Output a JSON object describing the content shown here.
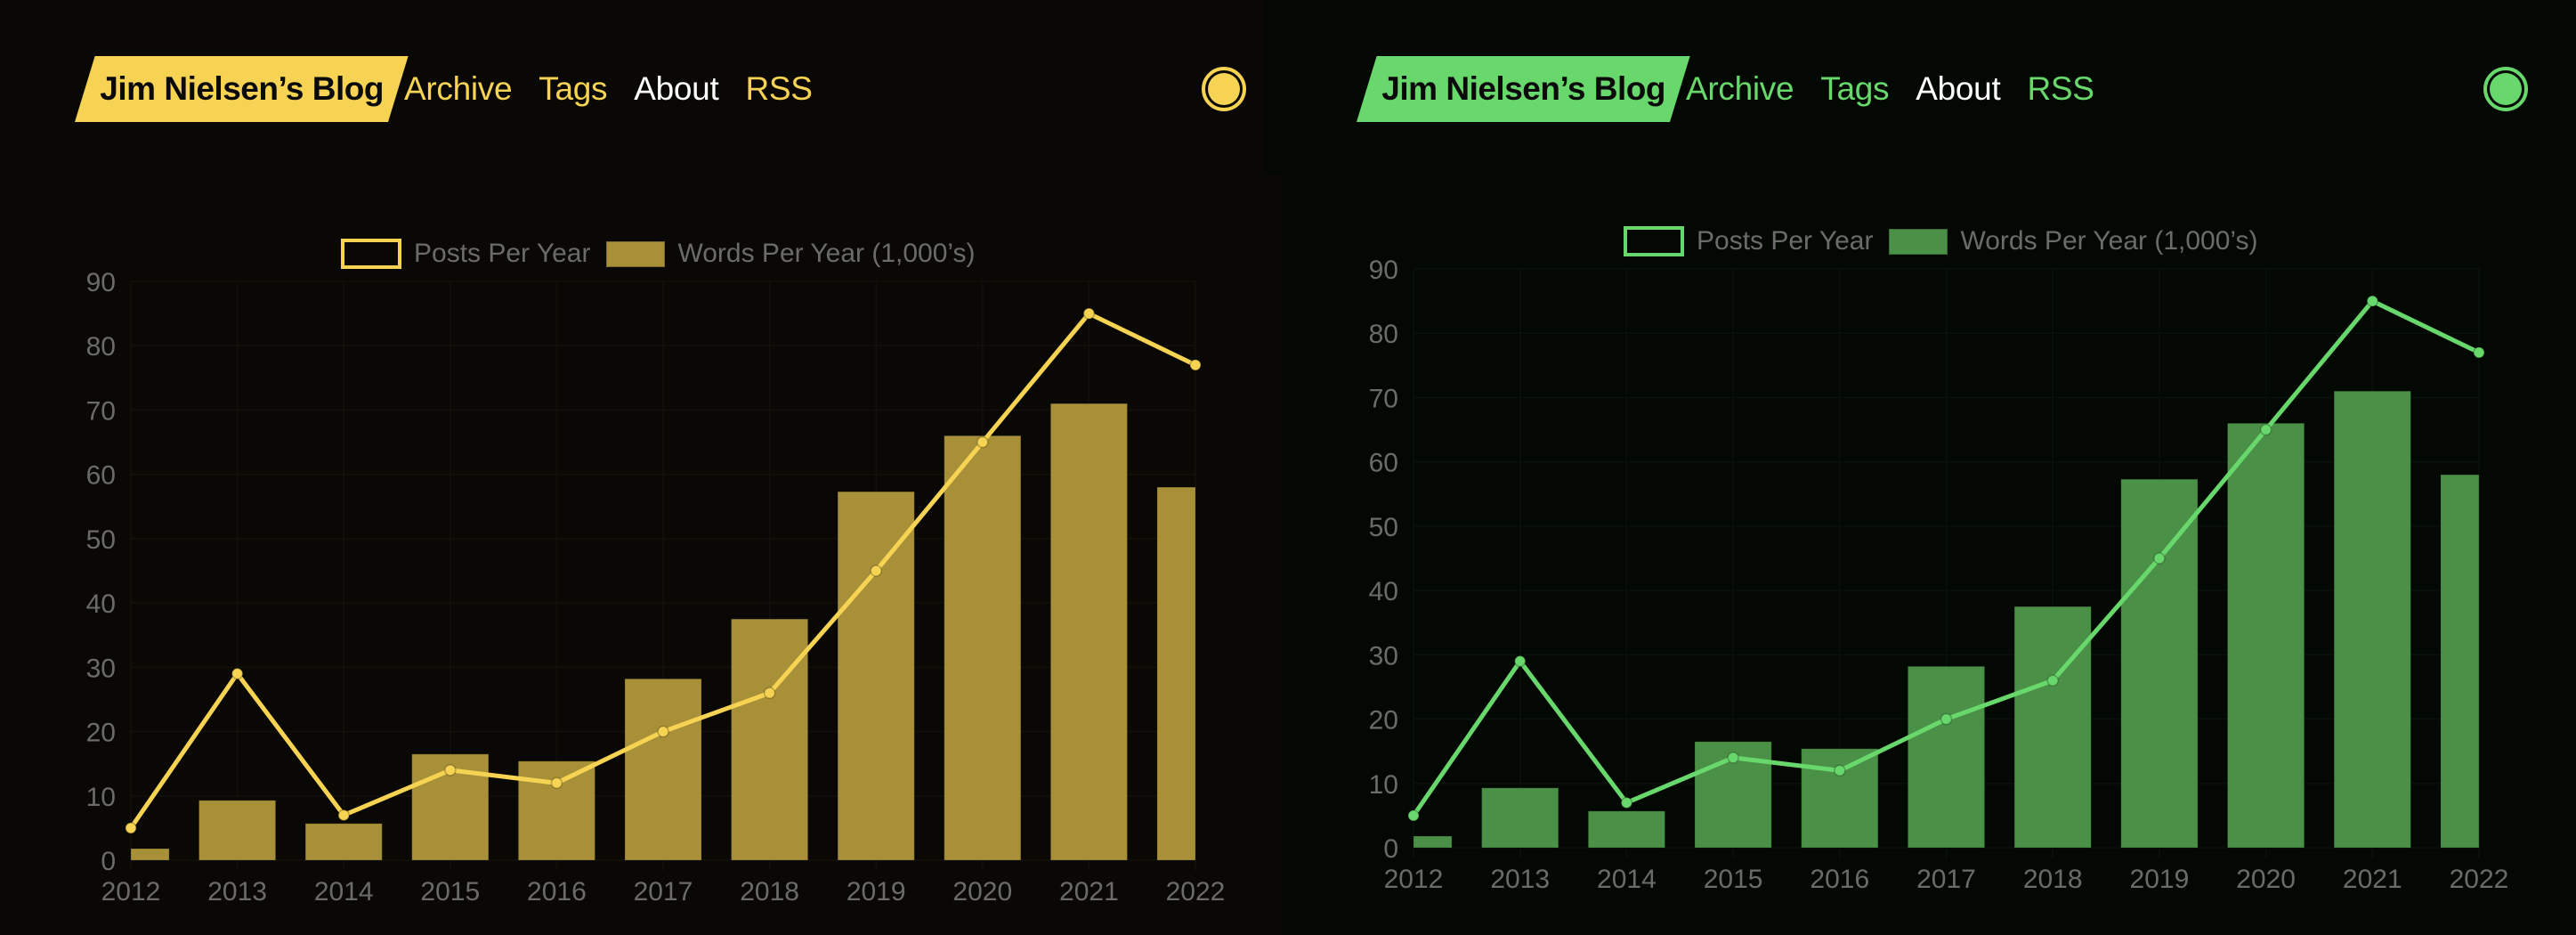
{
  "panels": [
    {
      "theme": "yellow",
      "colors": {
        "accent": "#f6d352",
        "bar": "#a89038",
        "line": "#f6d352",
        "background": "#0a0804",
        "grid": "#12100b",
        "nav_active": "#ffffff"
      },
      "header": {
        "logo": "Jim Nielsen’s Blog",
        "nav": [
          {
            "label": "Archive",
            "active": false
          },
          {
            "label": "Tags",
            "active": false
          },
          {
            "label": "About",
            "active": true
          },
          {
            "label": "RSS",
            "active": false
          }
        ],
        "theme_toggle_icon": "theme-circle-icon"
      }
    },
    {
      "theme": "green",
      "colors": {
        "accent": "#68d86c",
        "bar": "#4a9047",
        "line": "#68d86c",
        "background": "#030803",
        "grid": "#0a100a",
        "nav_active": "#ffffff"
      },
      "header": {
        "logo": "Jim Nielsen’s Blog",
        "nav": [
          {
            "label": "Archive",
            "active": false
          },
          {
            "label": "Tags",
            "active": false
          },
          {
            "label": "About",
            "active": true
          },
          {
            "label": "RSS",
            "active": false
          }
        ],
        "theme_toggle_icon": "theme-circle-icon"
      }
    }
  ],
  "chart_data": [
    {
      "type": "bar",
      "title": "",
      "xlabel": "",
      "ylabel": "",
      "categories": [
        "2012",
        "2013",
        "2014",
        "2015",
        "2016",
        "2017",
        "2018",
        "2019",
        "2020",
        "2021",
        "2022"
      ],
      "series": [
        {
          "name": "Posts Per Year",
          "type": "line",
          "values": [
            5,
            29,
            7,
            14,
            12,
            20,
            26,
            45,
            65,
            85,
            77
          ]
        },
        {
          "name": "Words Per Year (1,000’s)",
          "type": "bar",
          "values": [
            1.8,
            9.3,
            5.7,
            16.5,
            15.4,
            28.2,
            37.5,
            57.3,
            66,
            71,
            58
          ]
        }
      ],
      "ylim": [
        0,
        90
      ],
      "yticks": [
        0,
        10,
        20,
        30,
        40,
        50,
        60,
        70,
        80,
        90
      ],
      "grid": true,
      "legend": "top-center",
      "theme": "yellow"
    },
    {
      "type": "bar",
      "title": "",
      "xlabel": "",
      "ylabel": "",
      "categories": [
        "2012",
        "2013",
        "2014",
        "2015",
        "2016",
        "2017",
        "2018",
        "2019",
        "2020",
        "2021",
        "2022"
      ],
      "series": [
        {
          "name": "Posts Per Year",
          "type": "line",
          "values": [
            5,
            29,
            7,
            14,
            12,
            20,
            26,
            45,
            65,
            85,
            77
          ]
        },
        {
          "name": "Words Per Year (1,000’s)",
          "type": "bar",
          "values": [
            1.8,
            9.3,
            5.7,
            16.5,
            15.4,
            28.2,
            37.5,
            57.3,
            66,
            71,
            58
          ]
        }
      ],
      "ylim": [
        0,
        90
      ],
      "yticks": [
        0,
        10,
        20,
        30,
        40,
        50,
        60,
        70,
        80,
        90
      ],
      "grid": true,
      "legend": "top-center",
      "theme": "green"
    }
  ]
}
